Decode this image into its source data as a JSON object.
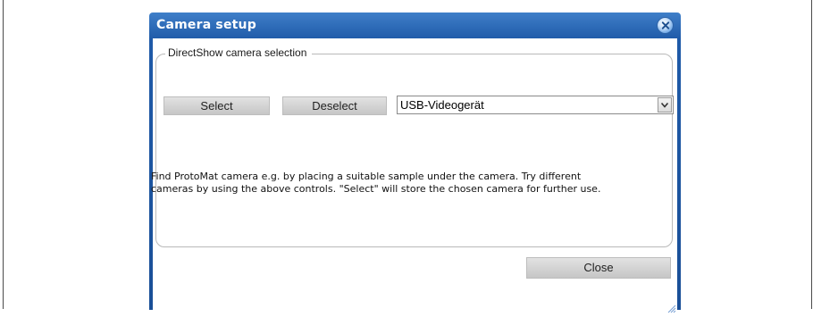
{
  "window": {
    "title": "Camera setup"
  },
  "group": {
    "legend": "DirectShow camera selection"
  },
  "buttons": {
    "select": "Select",
    "deselect": "Deselect",
    "close": "Close"
  },
  "camera_select": {
    "value": "USB-Videogerät"
  },
  "info": {
    "line1": "Find ProtoMat camera e.g. by placing a suitable sample under the camera. Try different",
    "line2": "cameras by using the above controls. \"Select\" will store the chosen camera for further use."
  },
  "colors": {
    "titlebar": "#1f5aa8",
    "button_face": "#d4d4d4"
  },
  "icons": {
    "close": "close-icon",
    "dropdown": "chevron-down-icon",
    "resize": "resize-grip-icon"
  }
}
